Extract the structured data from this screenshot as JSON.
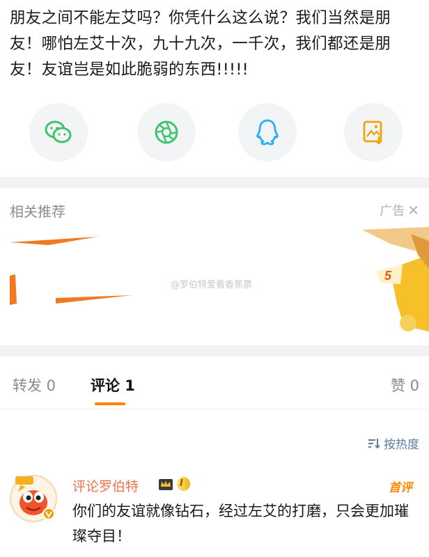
{
  "post": {
    "text": "朋友之间不能左艾吗？你凭什么这么说？我们当然是朋友！哪怕左艾十次，九十九次，一千次，我们都还是朋友！友谊岂是如此脆弱的东西!!!!!"
  },
  "share": {
    "items": [
      {
        "icon": "wechat-icon",
        "color": "#3ec46d"
      },
      {
        "icon": "moments-icon",
        "color": "#3ec46d"
      },
      {
        "icon": "qq-icon",
        "color": "#2aaef5"
      },
      {
        "icon": "save-image-icon",
        "color": "#f0a40a"
      }
    ]
  },
  "recommend": {
    "title": "相关推荐",
    "ad_label": "广告",
    "close_glyph": "✕",
    "ad_badge": "5",
    "watermark": "@罗伯特爱看香蕉票"
  },
  "tabs": {
    "repost": "转发 0",
    "comment": "评论 1",
    "like": "赞 0"
  },
  "sort": {
    "label": "按热度"
  },
  "comment": {
    "author": "评论罗伯特",
    "level": "I",
    "first_tag": "首评",
    "text": "你们的友谊就像钻石，经过左艾的打磨，只会更加璀璨夺目！"
  },
  "colors": {
    "accent": "#ff8200",
    "name": "#eb7350",
    "link": "#5b7ea4"
  }
}
